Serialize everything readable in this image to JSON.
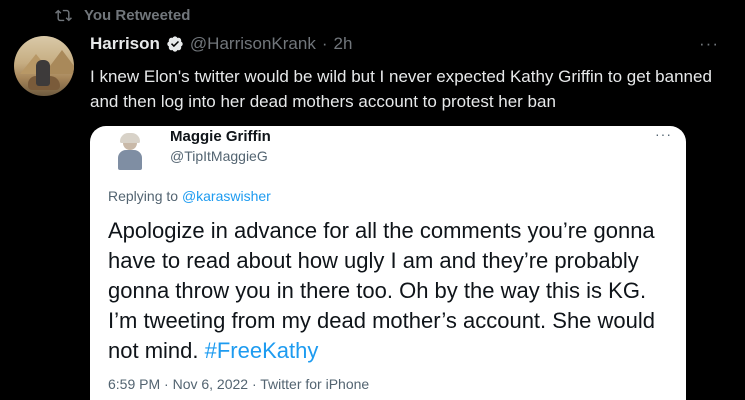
{
  "retweet": {
    "label": "You Retweeted",
    "icon": "retweet-icon"
  },
  "tweet": {
    "author_name": "Harrison",
    "verified": true,
    "handle": "@HarrisonKrank",
    "separator": "·",
    "time": "2h",
    "more": "···",
    "text": "I knew Elon's twitter would be wild but I never expected Kathy Griffin to get banned and then log into her dead mothers account to protest her ban"
  },
  "media": {
    "author_name": "Maggie Griffin",
    "handle": "@TipItMaggieG",
    "more": "···",
    "reply_prefix": "Replying to ",
    "reply_mention": "@karaswisher",
    "text": "Apologize in advance for all the comments you’re gonna have to read about how ugly I am and they’re probably gonna throw you in there too. Oh by the way this is KG. I’m tweeting from my dead mother’s account. She would not mind. ",
    "hashtag": "#FreeKathy",
    "meta": "6:59 PM · Nov 6, 2022 · Twitter for iPhone"
  },
  "colors": {
    "background": "#000000",
    "text_primary": "#e7e9ea",
    "text_secondary": "#71767b",
    "accent": "#1d9bf0",
    "card_background": "#ffffff"
  }
}
